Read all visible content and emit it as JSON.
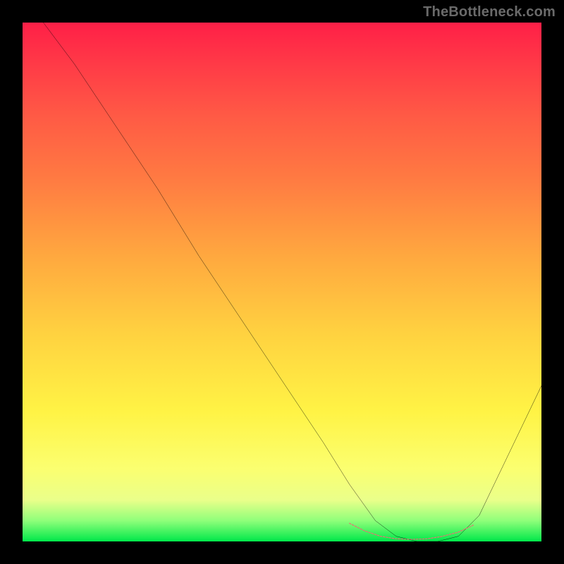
{
  "watermark": "TheBottleneck.com",
  "chart_data": {
    "type": "line",
    "title": "",
    "xlabel": "",
    "ylabel": "",
    "xlim": [
      0,
      100
    ],
    "ylim": [
      0,
      100
    ],
    "grid": false,
    "series": [
      {
        "name": "curve",
        "color": "#000000",
        "x": [
          4,
          10,
          18,
          26,
          34,
          42,
          50,
          58,
          63,
          68,
          72,
          76,
          80,
          84,
          88,
          100
        ],
        "y": [
          100,
          92,
          80,
          68,
          55,
          43,
          31,
          19,
          11,
          4,
          1,
          0,
          0,
          1,
          5,
          30
        ]
      },
      {
        "name": "bottom-accent",
        "color": "#e57373",
        "x": [
          63,
          66,
          69,
          72,
          75,
          78,
          81,
          84,
          87
        ],
        "y": [
          3.5,
          2.0,
          1.0,
          0.5,
          0.4,
          0.5,
          1.0,
          1.8,
          3.2
        ]
      }
    ]
  }
}
